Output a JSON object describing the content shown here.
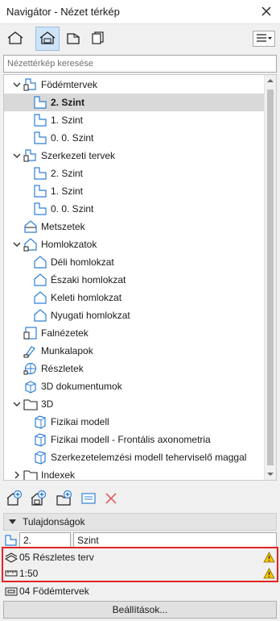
{
  "window": {
    "title": "Navigátor - Nézet térkép"
  },
  "search": {
    "placeholder": "Nézettérkép keresése"
  },
  "tree": [
    {
      "label": "Födémtervek",
      "icon": "folder-plan-icon",
      "expand": "open"
    },
    {
      "label": "2. Szint",
      "icon": "floor-plan-icon",
      "selected": true
    },
    {
      "label": "1. Szint",
      "icon": "floor-plan-icon"
    },
    {
      "label": "0. 0. Szint",
      "icon": "floor-plan-icon"
    },
    {
      "label": "Szerkezeti tervek",
      "icon": "folder-plan-icon",
      "expand": "open"
    },
    {
      "label": "2. Szint",
      "icon": "floor-plan-icon"
    },
    {
      "label": "1. Szint",
      "icon": "floor-plan-icon"
    },
    {
      "label": "0. 0. Szint",
      "icon": "floor-plan-icon"
    },
    {
      "label": "Metszetek",
      "icon": "section-icon"
    },
    {
      "label": "Homlokzatok",
      "icon": "elevation-icon",
      "expand": "open"
    },
    {
      "label": "Déli homlokzat",
      "icon": "elevation-item-icon"
    },
    {
      "label": "Északi homlokzat",
      "icon": "elevation-item-icon"
    },
    {
      "label": "Keleti homlokzat",
      "icon": "elevation-item-icon"
    },
    {
      "label": "Nyugati homlokzat",
      "icon": "elevation-item-icon"
    },
    {
      "label": "Falnézetek",
      "icon": "interior-elevation-icon"
    },
    {
      "label": "Munkalapok",
      "icon": "worksheet-icon"
    },
    {
      "label": "Részletek",
      "icon": "detail-icon"
    },
    {
      "label": "3D dokumentumok",
      "icon": "3d-document-icon"
    },
    {
      "label": "3D",
      "icon": "folder-icon",
      "expand": "open"
    },
    {
      "label": "Fizikai modell",
      "icon": "3d-view-icon"
    },
    {
      "label": "Fizikai modell - Frontális axonometria",
      "icon": "3d-view-icon"
    },
    {
      "label": "Szerkezetelemzési modell teherviselő maggal",
      "icon": "3d-view-icon"
    },
    {
      "label": "Indexek",
      "icon": "folder-icon",
      "expand": "closed"
    }
  ],
  "properties": {
    "header": "Tulajdonságok",
    "id_value": "2.",
    "name_value": "Szint",
    "model_view": "05 Részletes terv",
    "scale": "1:50",
    "layer_combination": "04 Födémtervek",
    "settings_button": "Beállítások..."
  },
  "colors": {
    "selection": "#d9d9d9",
    "highlight_border": "#e32424",
    "warning": "#f5c400",
    "add_icon": "#2f7fd6",
    "delete_icon": "#e06060"
  }
}
